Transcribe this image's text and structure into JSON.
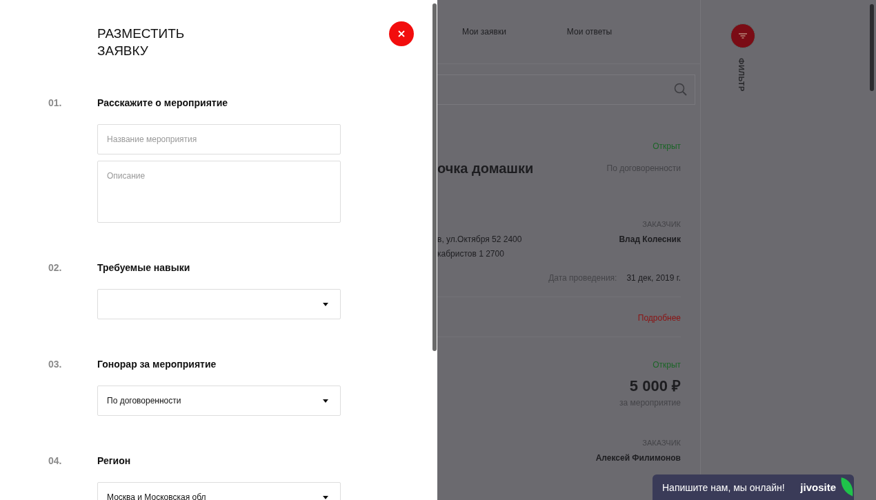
{
  "panel": {
    "title_lines": [
      "РАЗМЕСТИТЬ",
      "ЗАЯВКУ"
    ],
    "sections": [
      {
        "number": "01.",
        "heading": "Расскажите о мероприятие",
        "fields": [
          {
            "kind": "input",
            "placeholder": "Название мероприятия"
          },
          {
            "kind": "textarea",
            "placeholder": "Описание"
          }
        ]
      },
      {
        "number": "02.",
        "heading": "Требуемые навыки",
        "fields": [
          {
            "kind": "select"
          }
        ]
      },
      {
        "number": "03.",
        "heading": "Гонорар за мероприятие",
        "fields": [
          {
            "kind": "select",
            "value": "По договоренности"
          }
        ]
      },
      {
        "number": "04.",
        "heading": "Регион",
        "fields": [
          {
            "kind": "select",
            "value": "Москва и Московская обл"
          }
        ]
      }
    ]
  },
  "page": {
    "nav": [
      {
        "label": "Мои заявки"
      },
      {
        "label": "Мои ответы"
      }
    ],
    "filter_label": "ФИЛЬТР",
    "cards": [
      {
        "status": "Открыт",
        "title": "очка домашки",
        "price": "По договоренности",
        "customer_label": "ЗАКАЗЧИК",
        "customer": "Влад Колесник",
        "address_lines": [
          "в, ул.Октября 52 2400",
          "кабристов 1 2700"
        ],
        "date_label": "Дата проведения:",
        "date": "31 дек, 2019 г.",
        "link": "Подробнее"
      },
      {
        "status": "Открыт",
        "price": "5 000 ₽",
        "price_note": "за мероприятие",
        "customer_label": "ЗАКАЗЧИК",
        "customer": "Алексей Филимонов"
      }
    ]
  },
  "chat": {
    "message": "Напишите нам, мы онлайн!",
    "brand": "jivosite"
  }
}
